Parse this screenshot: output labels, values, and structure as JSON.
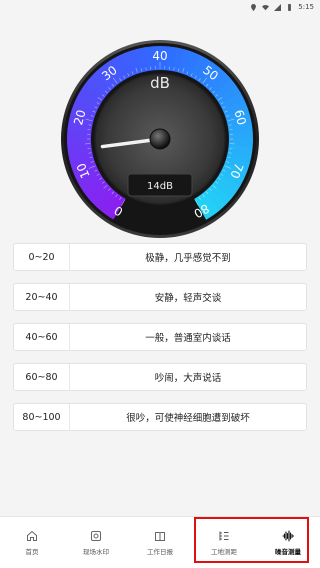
{
  "status_bar": {
    "time": "5:15"
  },
  "gauge": {
    "unit": "dB",
    "current_value": 14,
    "readout": "14dB",
    "scale_ticks": [
      "0",
      "10",
      "20",
      "30",
      "40",
      "50",
      "60",
      "70",
      "80"
    ],
    "scale_min": 0,
    "scale_max": 80
  },
  "levels": [
    {
      "range": "0~20",
      "desc": "极静，几乎感觉不到"
    },
    {
      "range": "20~40",
      "desc": "安静，轻声交谈"
    },
    {
      "range": "40~60",
      "desc": "一般，普通室内谈话"
    },
    {
      "range": "60~80",
      "desc": "吵闹，大声说话"
    },
    {
      "range": "80~100",
      "desc": "很吵，可使神经细胞遭到破坏"
    }
  ],
  "tabs": [
    {
      "label": "首页",
      "icon": "home-icon",
      "active": false
    },
    {
      "label": "现场水印",
      "icon": "camera-icon",
      "active": false
    },
    {
      "label": "工作日报",
      "icon": "book-icon",
      "active": false
    },
    {
      "label": "工地测距",
      "icon": "ruler-list-icon",
      "active": false
    },
    {
      "label": "噪音测量",
      "icon": "soundwave-icon",
      "active": true
    }
  ],
  "colors": {
    "gauge_start": "#8a20f0",
    "gauge_mid": "#2f6bff",
    "gauge_end": "#22d6f5",
    "highlight": "#e01010"
  }
}
